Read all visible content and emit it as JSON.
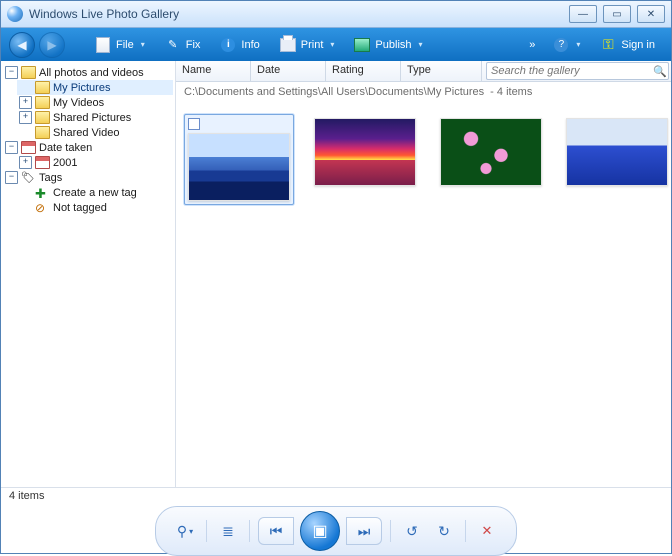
{
  "window": {
    "title": "Windows Live Photo Gallery"
  },
  "caption": {
    "min": "—",
    "max": "▭",
    "close": "✕"
  },
  "toolbar": {
    "file": "File",
    "fix": "Fix",
    "info": "Info",
    "print": "Print",
    "publish": "Publish",
    "signin": "Sign in"
  },
  "tree": {
    "root": "All photos and videos",
    "my_pictures": "My Pictures",
    "my_videos": "My Videos",
    "shared_pictures": "Shared Pictures",
    "shared_video": "Shared Video",
    "date_taken": "Date taken",
    "year": "2001",
    "tags": "Tags",
    "create_tag": "Create a new tag",
    "not_tagged": "Not tagged"
  },
  "columns": {
    "name": "Name",
    "date": "Date",
    "rating": "Rating",
    "type": "Type"
  },
  "search": {
    "placeholder": "Search the gallery"
  },
  "path": {
    "text": "C:\\Documents and Settings\\All Users\\Documents\\My Pictures",
    "count": "- 4 items"
  },
  "status": {
    "text": "4 items"
  },
  "footer": {
    "zoom": "⚲",
    "details": "≣",
    "prev": "⏮",
    "play": "▣",
    "next": "⏭",
    "undo": "↺",
    "redo": "↻",
    "delete": "✕"
  }
}
